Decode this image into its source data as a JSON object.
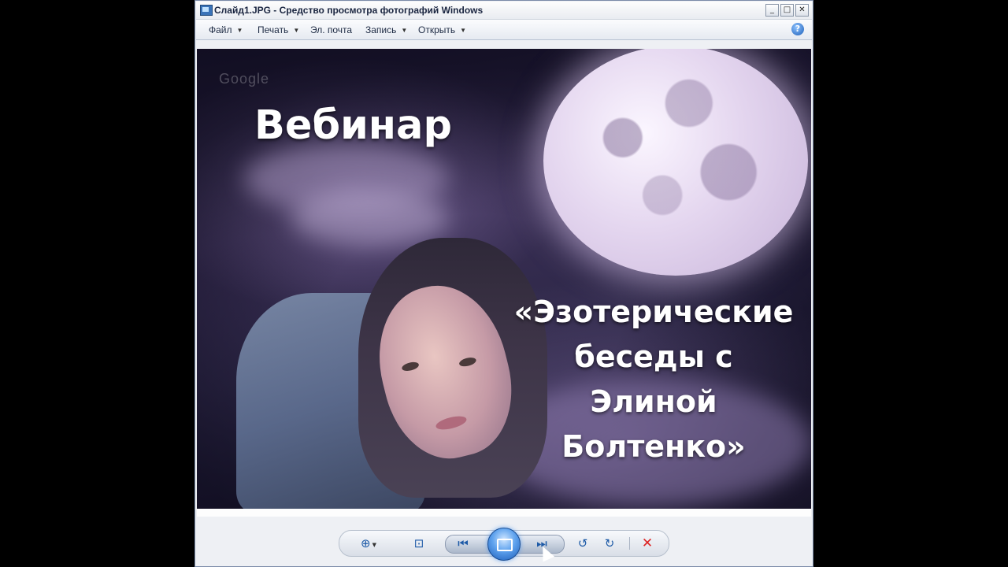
{
  "window": {
    "title": "Слайд1.JPG - Средство просмотра фотографий Windows",
    "buttons": {
      "minimize": "_",
      "maximize": "□",
      "close": "✕"
    }
  },
  "menu": {
    "items": [
      {
        "label": "Файл",
        "has_dropdown": true
      },
      {
        "label": "Печать",
        "has_dropdown": true
      },
      {
        "label": "Эл. почта",
        "has_dropdown": false
      },
      {
        "label": "Запись",
        "has_dropdown": true
      },
      {
        "label": "Открыть",
        "has_dropdown": true
      }
    ],
    "help_icon": "help-icon"
  },
  "photo": {
    "title": "Вебинар",
    "subtitle_lines": [
      "«Эзотерические",
      "беседы с Элиной",
      "Болтенко»"
    ],
    "watermark": "Google"
  },
  "controls": {
    "zoom": {
      "icon": "zoom-icon",
      "glyph": "⊕"
    },
    "actual_size": {
      "icon": "fit-window-icon",
      "glyph": "⊡"
    },
    "previous": {
      "icon": "previous-icon",
      "glyph": "⏮"
    },
    "slideshow": {
      "icon": "slideshow-icon"
    },
    "next": {
      "icon": "next-icon",
      "glyph": "⏭"
    },
    "rotate_ccw": {
      "icon": "rotate-counterclockwise-icon",
      "glyph": "↺"
    },
    "rotate_cw": {
      "icon": "rotate-clockwise-icon",
      "glyph": "↻"
    },
    "delete": {
      "icon": "delete-icon",
      "glyph": "✕"
    }
  },
  "colors": {
    "accent": "#1d5aa7",
    "delete": "#dd2222"
  }
}
